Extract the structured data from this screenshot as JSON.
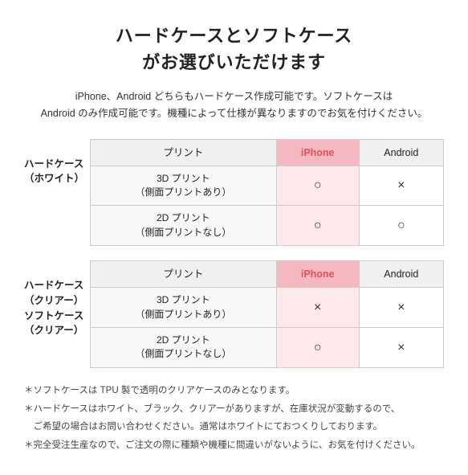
{
  "title": {
    "line1": "ハードケースとソフトケース",
    "line2": "がお選びいただけます"
  },
  "subtitle": "iPhone、Android どちらもハードケース作成可能です。ソフトケースは\nAndroid のみ作成可能です。機種によって仕様が異なりますのでお気を付けください。",
  "section1": {
    "row_label_line1": "ハードケース",
    "row_label_line2": "（ホワイト）",
    "col_print": "プリント",
    "col_iphone": "iPhone",
    "col_android": "Android",
    "rows": [
      {
        "print": "3D プリント\n（側面プリントあり）",
        "iphone": "○",
        "android": "×"
      },
      {
        "print": "2D プリント\n（側面プリントなし）",
        "iphone": "○",
        "android": "○"
      }
    ]
  },
  "section2": {
    "row_label_line1": "ハードケース",
    "row_label_line2": "（クリアー）",
    "row_label2_line1": "ソフトケース",
    "row_label2_line2": "（クリアー）",
    "col_print": "プリント",
    "col_iphone": "iPhone",
    "col_android": "Android",
    "rows": [
      {
        "print": "3D プリント\n（側面プリントあり）",
        "iphone": "×",
        "android": "×"
      },
      {
        "print": "2D プリント\n（側面プリントなし）",
        "iphone": "○",
        "android": "×"
      }
    ]
  },
  "notes": [
    "＊ソフトケースは TPU 製で透明のクリアケースのみとなります。",
    "＊ハードケースはホワイト、ブラック、クリアーがありますが、在庫状況が変動するので、",
    "　ご希望の場合はお問い合わせください。通常はホワイトにておつくりしております。",
    "＊完全受注生産なので、ご注文の際に種類や機種に間違いがないように、お気を付けください。"
  ]
}
